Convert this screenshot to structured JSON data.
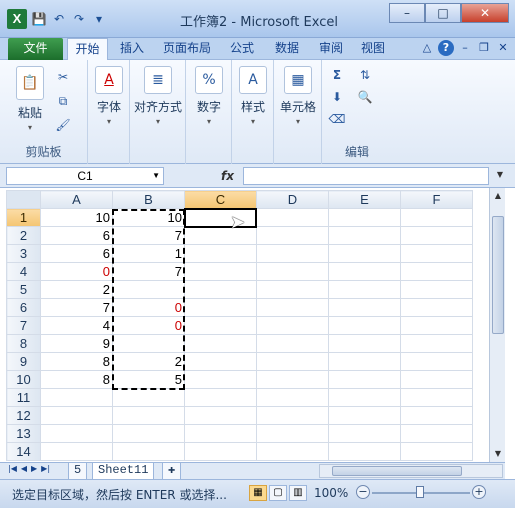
{
  "app": {
    "title": "工作簿2 - Microsoft Excel",
    "icon": "excel-icon"
  },
  "qat": {
    "save_icon": "💾",
    "undo_icon": "↶",
    "redo_icon": "↷",
    "customize_icon": "▾"
  },
  "window": {
    "minimize": "–",
    "maximize": "□",
    "close": "✕"
  },
  "tabs": [
    {
      "label": "文件"
    },
    {
      "label": "开始"
    },
    {
      "label": "插入"
    },
    {
      "label": "页面布局"
    },
    {
      "label": "公式"
    },
    {
      "label": "数据"
    },
    {
      "label": "审阅"
    },
    {
      "label": "视图"
    }
  ],
  "ribbon": {
    "clipboard": {
      "paste": "粘贴",
      "label": "剪贴板"
    },
    "font": {
      "label": "字体"
    },
    "alignment": {
      "label": "对齐方式"
    },
    "number": {
      "label": "数字"
    },
    "styles": {
      "label": "样式"
    },
    "cells": {
      "label": "单元格"
    },
    "editing": {
      "label": "编辑"
    }
  },
  "formula_bar": {
    "name_box": "C1",
    "fx": "fx",
    "value": ""
  },
  "sheet": {
    "columns": [
      "A",
      "B",
      "C",
      "D",
      "E",
      "F"
    ],
    "rows": [
      {
        "n": "1",
        "a": "10",
        "b": "10"
      },
      {
        "n": "2",
        "a": "6",
        "b": "7"
      },
      {
        "n": "3",
        "a": "6",
        "b": "1"
      },
      {
        "n": "4",
        "a": "0",
        "b": "7"
      },
      {
        "n": "5",
        "a": "2",
        "b": ""
      },
      {
        "n": "6",
        "a": "7",
        "b": "0"
      },
      {
        "n": "7",
        "a": "4",
        "b": "0"
      },
      {
        "n": "8",
        "a": "9",
        "b": ""
      },
      {
        "n": "9",
        "a": "8",
        "b": "2"
      },
      {
        "n": "10",
        "a": "8",
        "b": "5"
      },
      {
        "n": "11",
        "a": "",
        "b": ""
      },
      {
        "n": "12",
        "a": "",
        "b": ""
      },
      {
        "n": "13",
        "a": "",
        "b": ""
      },
      {
        "n": "14",
        "a": "",
        "b": ""
      }
    ],
    "red_color": "#cc0000"
  },
  "sheet_tabs": [
    "5",
    "Sheet11"
  ],
  "status": {
    "text": "选定目标区域，然后按 ENTER 或选择...",
    "zoom": "100%"
  }
}
